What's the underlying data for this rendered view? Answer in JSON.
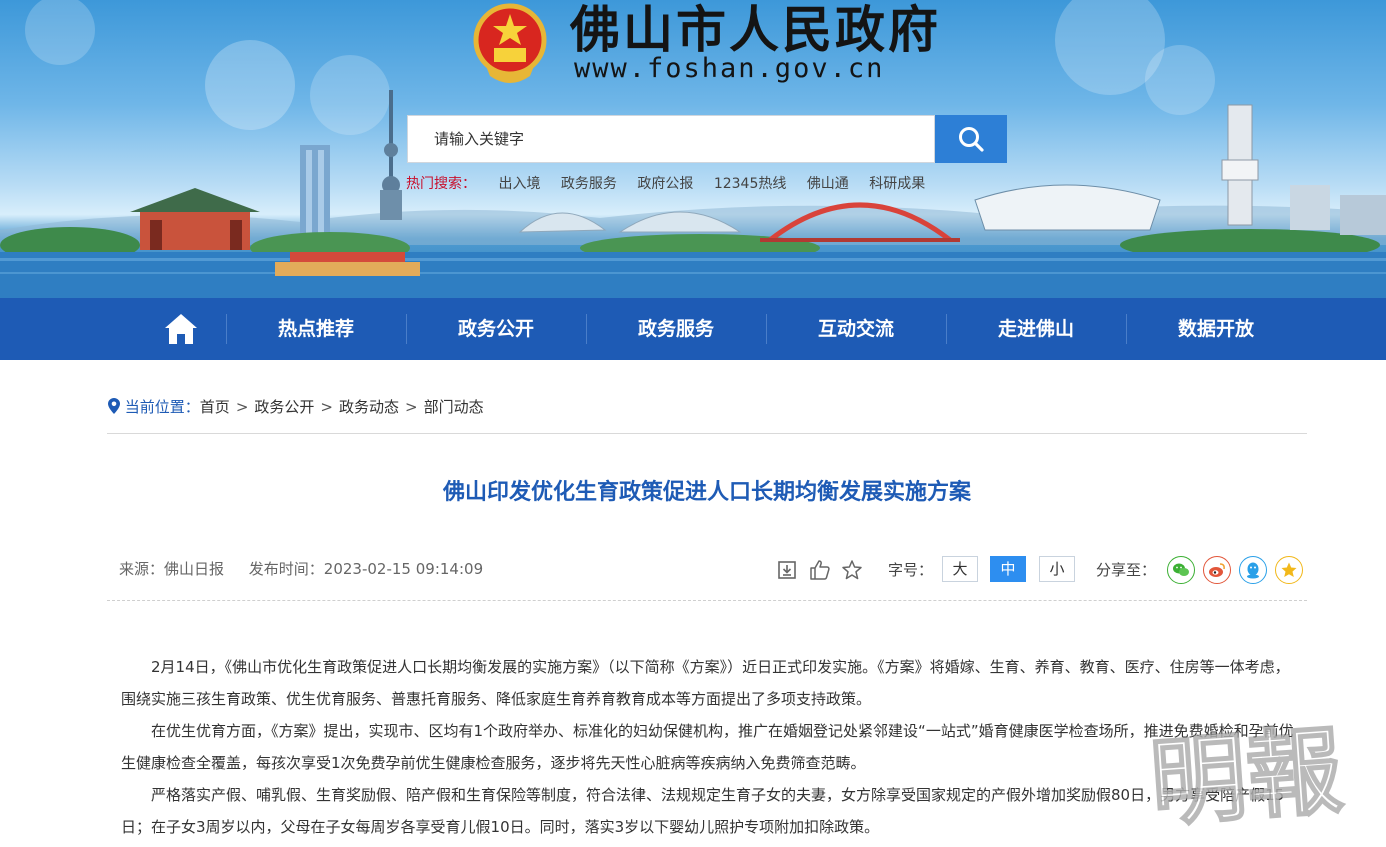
{
  "header": {
    "site_title": "佛山市人民政府",
    "site_url": "www.foshan.gov.cn",
    "search": {
      "placeholder": "请输入关键字"
    },
    "hot_search": {
      "label": "热门搜索：",
      "items": [
        "出入境",
        "政务服务",
        "政府公报",
        "12345热线",
        "佛山通",
        "科研成果"
      ]
    }
  },
  "nav": {
    "home_icon": "home-icon",
    "items": [
      "热点推荐",
      "政务公开",
      "政务服务",
      "互动交流",
      "走进佛山",
      "数据开放"
    ]
  },
  "breadcrumb": {
    "label": "当前位置：",
    "items": [
      "首页",
      "政务公开",
      "政务动态",
      "部门动态"
    ]
  },
  "article": {
    "title": "佛山印发优化生育政策促进人口长期均衡发展实施方案",
    "source": "来源：佛山日报",
    "publish_time": "发布时间：2023-02-15 09:14:09",
    "font_size_label": "字号：",
    "font_sizes": [
      "大",
      "中",
      "小"
    ],
    "font_size_active": "中",
    "share_label": "分享至：",
    "paragraphs": [
      "2月14日，《佛山市优化生育政策促进人口长期均衡发展的实施方案》（以下简称《方案》）近日正式印发实施。《方案》将婚嫁、生育、养育、教育、医疗、住房等一体考虑，围绕实施三孩生育政策、优生优育服务、普惠托育服务、降低家庭生育养育教育成本等方面提出了多项支持政策。",
      "在优生优育方面，《方案》提出，实现市、区均有1个政府举办、标准化的妇幼保健机构，推广在婚姻登记处紧邻建设“一站式”婚育健康医学检查场所，推进免费婚检和孕前优生健康检查全覆盖，每孩次享受1次免费孕前优生健康检查服务，逐步将先天性心脏病等疾病纳入免费筛查范畴。",
      "严格落实产假、哺乳假、生育奖励假、陪产假和生育保险等制度，符合法律、法规规定生育子女的夫妻，女方除享受国家规定的产假外增加奖励假80日，男方享受陪产假15日；在子女3周岁以内，父母在子女每周岁各享受育儿假10日。同时，落实3岁以下婴幼儿照护专项附加扣除政策。"
    ]
  },
  "watermark": {
    "text": "明報"
  },
  "colors": {
    "brand_blue": "#1e5bb5",
    "hot_red": "#c8102e",
    "accent": "#2d8ef0"
  }
}
